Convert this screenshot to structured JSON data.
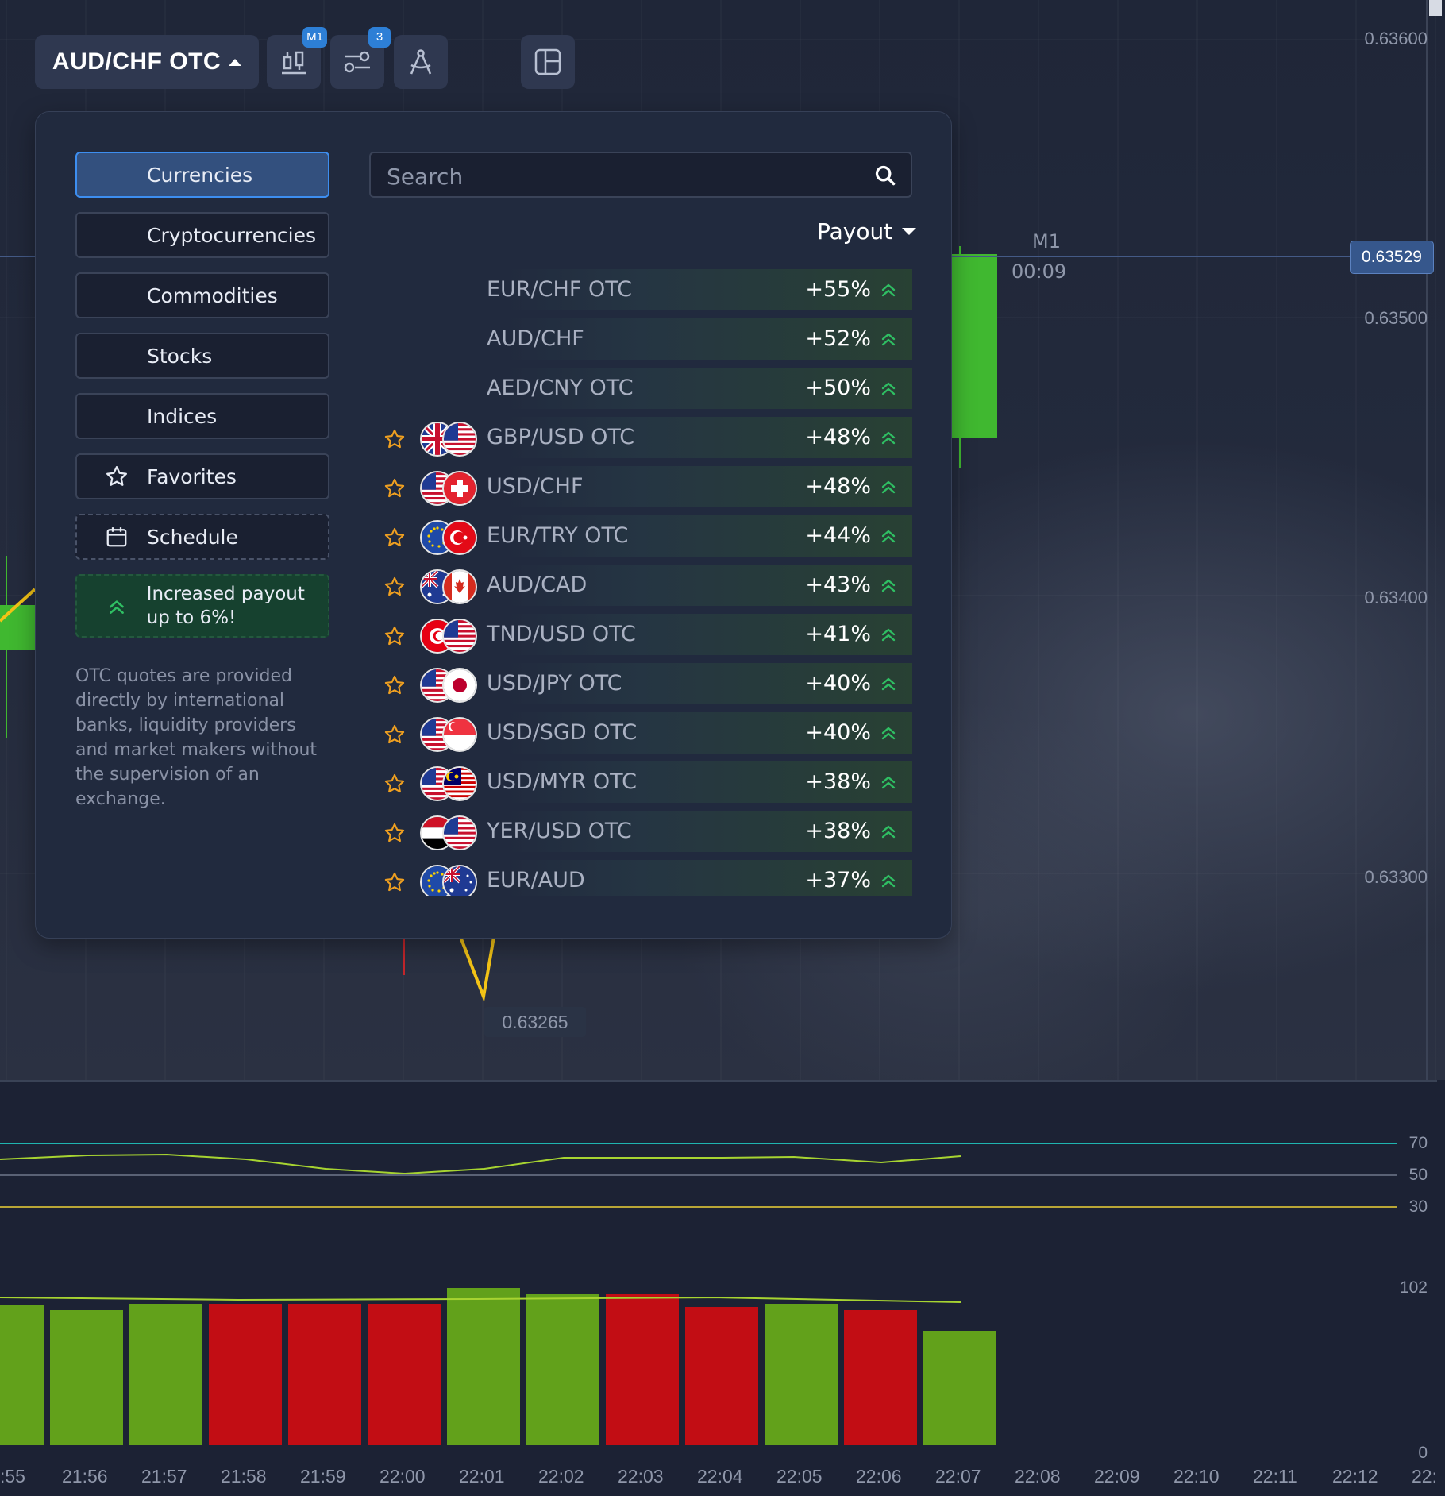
{
  "toolbar": {
    "pair": "AUD/CHF OTC",
    "timeframe_badge": "M1",
    "indicators_badge": "3"
  },
  "panel": {
    "categories": [
      {
        "label": "Currencies",
        "active": true
      },
      {
        "label": "Cryptocurrencies"
      },
      {
        "label": "Commodities"
      },
      {
        "label": "Stocks"
      },
      {
        "label": "Indices"
      },
      {
        "label": "Favorites",
        "icon": "star-outline-icon"
      },
      {
        "label": "Schedule",
        "icon": "calendar-icon"
      },
      {
        "label": "Increased payout up to 6%!",
        "icon": "double-chevron-up-icon"
      }
    ],
    "otc_note": "OTC quotes are provided directly by international banks, liquidity providers and market makers without the supervision of an exchange.",
    "search_placeholder": "Search",
    "sort_label": "Payout",
    "assets": [
      {
        "name": "EUR/CHF OTC",
        "payout": "+55%",
        "flags": []
      },
      {
        "name": "AUD/CHF",
        "payout": "+52%",
        "flags": []
      },
      {
        "name": "AED/CNY OTC",
        "payout": "+50%",
        "flags": []
      },
      {
        "name": "GBP/USD OTC",
        "payout": "+48%",
        "flags": [
          "gb",
          "us"
        ]
      },
      {
        "name": "USD/CHF",
        "payout": "+48%",
        "flags": [
          "us",
          "ch"
        ]
      },
      {
        "name": "EUR/TRY OTC",
        "payout": "+44%",
        "flags": [
          "eu",
          "tr"
        ]
      },
      {
        "name": "AUD/CAD",
        "payout": "+43%",
        "flags": [
          "au",
          "ca"
        ]
      },
      {
        "name": "TND/USD OTC",
        "payout": "+41%",
        "flags": [
          "tn",
          "us"
        ]
      },
      {
        "name": "USD/JPY OTC",
        "payout": "+40%",
        "flags": [
          "us",
          "jp"
        ]
      },
      {
        "name": "USD/SGD OTC",
        "payout": "+40%",
        "flags": [
          "us",
          "sg"
        ]
      },
      {
        "name": "USD/MYR OTC",
        "payout": "+38%",
        "flags": [
          "us",
          "my"
        ]
      },
      {
        "name": "YER/USD OTC",
        "payout": "+38%",
        "flags": [
          "ye",
          "us"
        ]
      },
      {
        "name": "EUR/AUD",
        "payout": "+37%",
        "flags": [
          "eu",
          "au"
        ]
      }
    ]
  },
  "chart": {
    "price_labels": [
      "0.63600",
      "0.63500",
      "0.63400",
      "0.63300"
    ],
    "current_price": "0.63529",
    "timeframe_label": "M1",
    "timer": "00:09",
    "low_label": "0.63265",
    "oscillator_levels": [
      "70",
      "50",
      "30"
    ],
    "volume_levels": [
      "102",
      "0"
    ],
    "time_labels": [
      ":55",
      "21:56",
      "21:57",
      "21:58",
      "21:59",
      "22:00",
      "22:01",
      "22:02",
      "22:03",
      "22:04",
      "22:05",
      "22:06",
      "22:07",
      "22:08",
      "22:09",
      "22:10",
      "22:11",
      "22:12",
      "22:"
    ],
    "volume_bars": [
      {
        "value": 88,
        "color": "green"
      },
      {
        "value": 85,
        "color": "green"
      },
      {
        "value": 89,
        "color": "green"
      },
      {
        "value": 89,
        "color": "red"
      },
      {
        "value": 89,
        "color": "red"
      },
      {
        "value": 89,
        "color": "red"
      },
      {
        "value": 99,
        "color": "green"
      },
      {
        "value": 95,
        "color": "green"
      },
      {
        "value": 95,
        "color": "red"
      },
      {
        "value": 87,
        "color": "red"
      },
      {
        "value": 89,
        "color": "green"
      },
      {
        "value": 85,
        "color": "red"
      },
      {
        "value": 72,
        "color": "green"
      }
    ]
  },
  "colors": {
    "accent": "#3d8ef0",
    "green": "#62a11b",
    "red": "#c20d14",
    "candle_green": "#40b830"
  }
}
